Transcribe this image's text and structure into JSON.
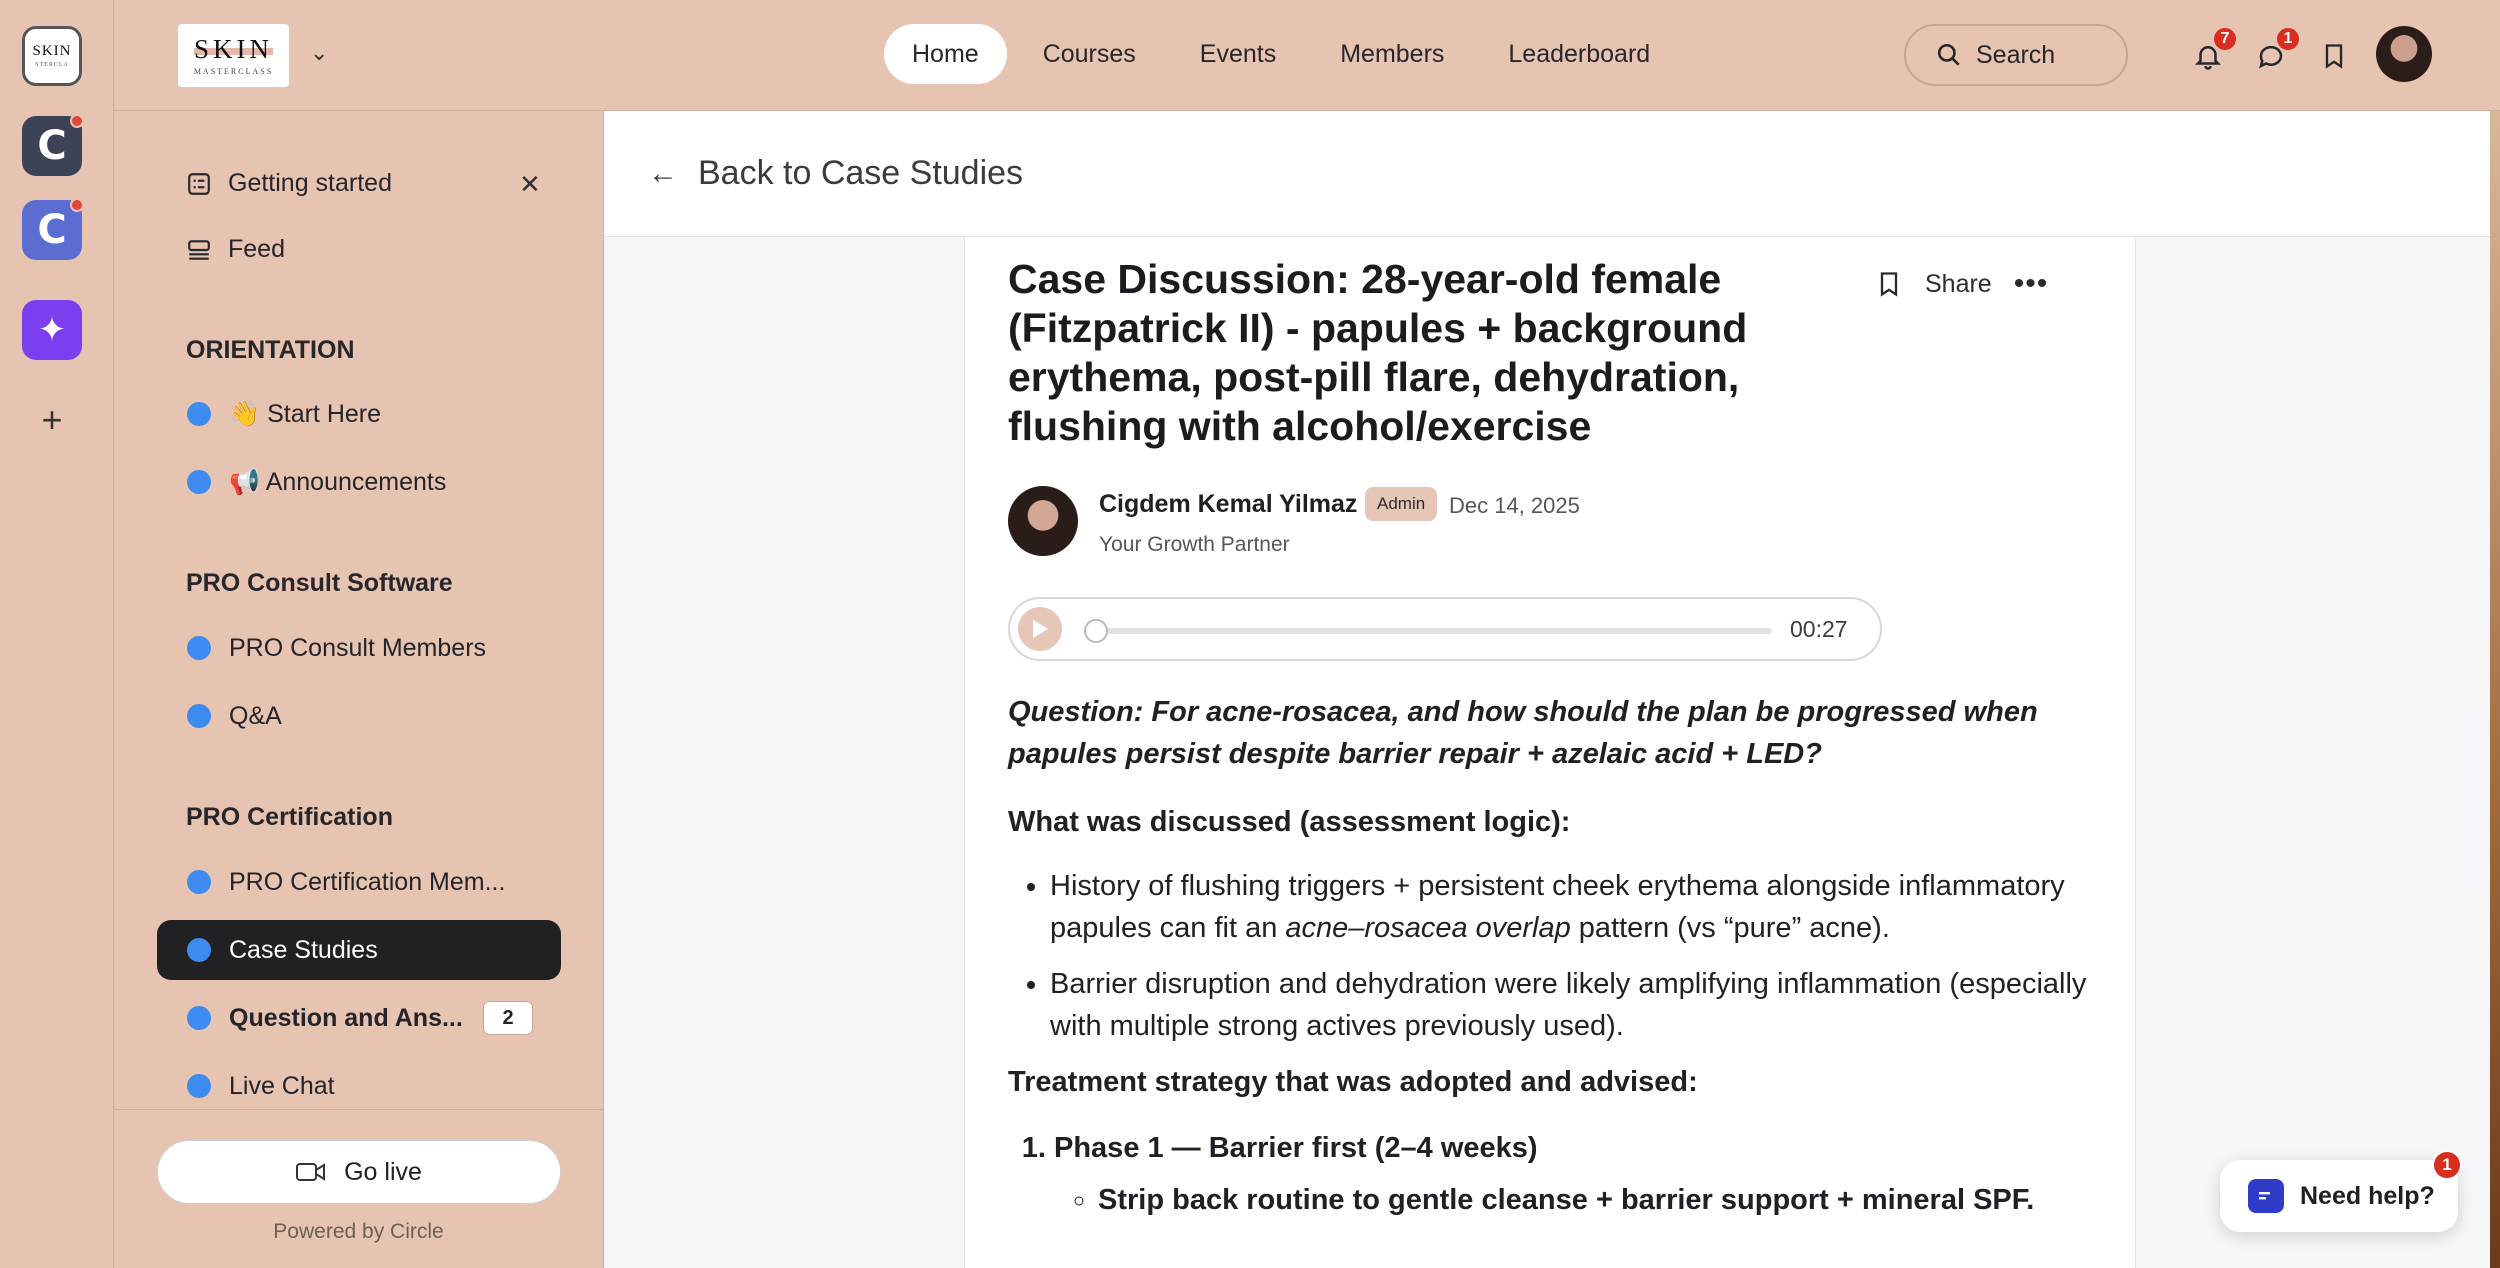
{
  "rail": {
    "brand_top": "SKIN",
    "brand_bottom": "STERCLA",
    "apps": [
      {
        "letter": "C"
      },
      {
        "letter": "C"
      }
    ]
  },
  "header": {
    "logo_text": "SKIN",
    "logo_subtext": "MASTERCLASS",
    "nav": [
      "Home",
      "Courses",
      "Events",
      "Members",
      "Leaderboard"
    ],
    "active_nav": "Home",
    "search_label": "Search",
    "notifications_count": "7",
    "messages_count": "1"
  },
  "sidebar": {
    "getting_started": "Getting started",
    "feed": "Feed",
    "sections": [
      {
        "title": "ORIENTATION",
        "items": [
          "👋 Start Here",
          "📢 Announcements"
        ]
      },
      {
        "title": "PRO Consult Software",
        "items": [
          "PRO Consult Members",
          "Q&A"
        ]
      },
      {
        "title": "PRO Certification",
        "items": [
          "PRO Certification Mem...",
          "Case Studies",
          "Question and Ans...",
          "Live Chat"
        ]
      }
    ],
    "active_item": "Case Studies",
    "qa_count": "2",
    "go_live": "Go live",
    "powered_by": "Powered by Circle"
  },
  "main": {
    "back_link": "Back to Case Studies",
    "post": {
      "title": "Case Discussion: 28-year-old female (Fitzpatrick II) - papules + background erythema, post-pill flare, dehydration, flushing with alcohol/exercise",
      "share": "Share",
      "author": "Cigdem Kemal Yilmaz",
      "author_badge": "Admin",
      "date": "Dec 14, 2025",
      "author_role": "Your Growth Partner",
      "audio_time": "00:27",
      "audio_progress": 0,
      "question": "Question:  For acne-rosacea, and how should the plan be progressed when papules persist despite barrier repair + azelaic acid + LED?",
      "discussed_heading": "What was discussed (assessment logic):",
      "bullet1_a": "History of flushing triggers + persistent cheek erythema alongside inflammatory papules can fit an ",
      "bullet1_em": "acne–rosacea overlap",
      "bullet1_b": " pattern (vs “pure” acne).",
      "bullet2": "Barrier disruption and dehydration were likely amplifying inflammation (especially with multiple strong actives previously used).",
      "strategy_heading": "Treatment strategy that was adopted and advised:",
      "phase1": "Phase 1 — Barrier first (2–4 weeks)",
      "phase1_bullet": "Strip back routine to gentle cleanse + barrier support + mineral SPF."
    }
  },
  "help": {
    "label": "Need help?",
    "count": "1"
  }
}
